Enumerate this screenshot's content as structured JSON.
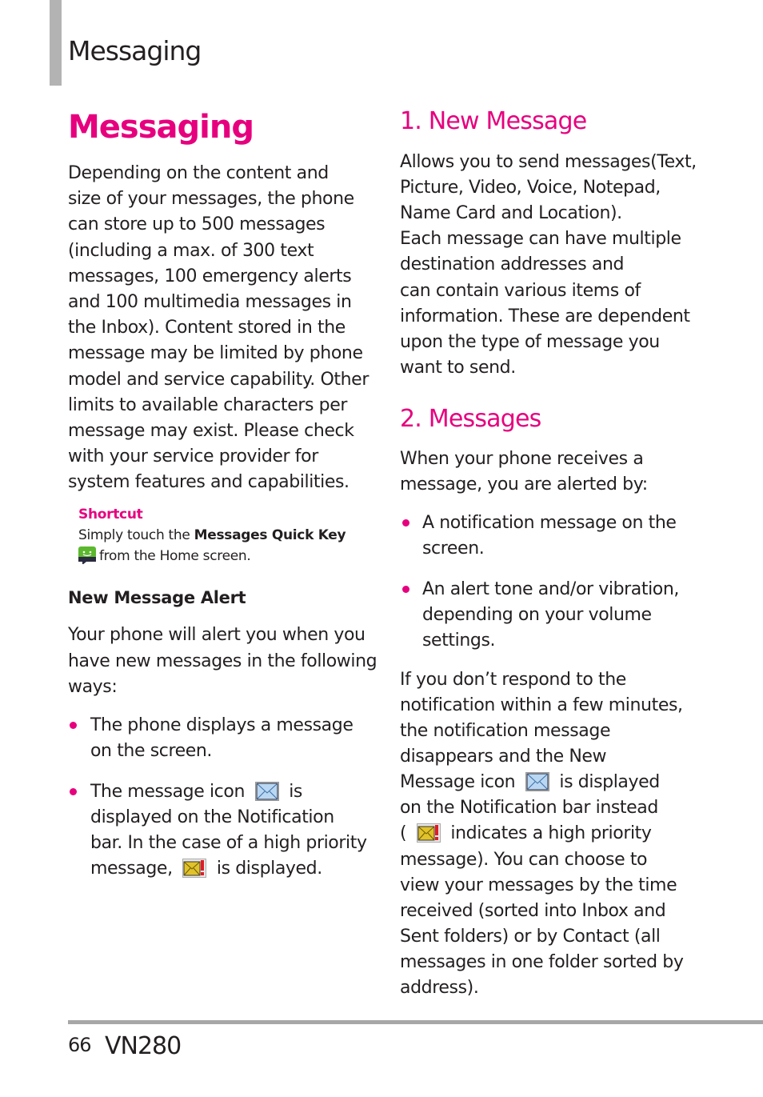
{
  "header": {
    "section": "Messaging"
  },
  "left": {
    "title": "Messaging",
    "intro": [
      "Depending on the content and",
      "size of your messages, the phone",
      "can store up to 500 messages",
      "(including a max. of 300 text",
      "messages, 100 emergency alerts",
      "and 100 multimedia messages in",
      "the Inbox). Content stored in the",
      "message may be limited by phone",
      "model and service capability. Other",
      "limits to available characters per",
      "message may exist. Please check",
      "with your service provider for",
      "system features and capabilities."
    ],
    "shortcut": {
      "label": "Shortcut",
      "line1_pre": "Simply touch the ",
      "line1_bold": "Messages Quick Key",
      "line2": "from the Home screen.",
      "icon": "messages-quick-key-icon"
    },
    "alert_heading": "New Message Alert",
    "alert_intro": [
      "Your phone will alert you when you",
      "have new messages in the following",
      "ways:"
    ],
    "bullets": {
      "b1": [
        "The phone displays a message",
        "on the screen."
      ],
      "b2_l1_pre": "The message icon",
      "b2_l1_post": "is",
      "b2_l2": "displayed on the Notification",
      "b2_l3": "bar. In the case of a high priority",
      "b2_l4_pre": "message,",
      "b2_l4_post": "is displayed."
    }
  },
  "right": {
    "s1_heading": "1. New Message",
    "s1_text": [
      "Allows you to send messages(Text,",
      "Picture, Video, Voice, Notepad,",
      "Name Card and Location).",
      "Each message can have multiple",
      "destination addresses and",
      "can contain various items of",
      "information. These are dependent",
      "upon the type of message you",
      "want to send."
    ],
    "s2_heading": "2. Messages",
    "s2_intro": [
      "When your phone receives a",
      "message, you are alerted by:"
    ],
    "s2_bullets": [
      [
        "A notification message on the",
        "screen."
      ],
      [
        "An alert tone and/or vibration,",
        "depending on your volume",
        "settings."
      ]
    ],
    "s2_para": {
      "l1": "If you don’t respond to the",
      "l2": "notification within a few minutes,",
      "l3": "the notification message",
      "l4": "disappears and the New",
      "l5_pre": "Message icon",
      "l5_post": "is displayed",
      "l6": "on the Notification bar instead",
      "l7_pre": "(",
      "l7_post": "indicates a high priority",
      "l8": "message). You can choose to",
      "l9": "view your messages by the time",
      "l10": "received (sorted into Inbox and",
      "l11": "Sent folders) or by Contact (all",
      "l12": "messages in one folder sorted by",
      "l13": "address)."
    }
  },
  "footer": {
    "page_number": "66",
    "model": "VN280"
  },
  "colors": {
    "accent": "#e6007e",
    "rule": "#a7a7a7",
    "side_bar": "#b3b3b3",
    "text": "#231f20"
  }
}
